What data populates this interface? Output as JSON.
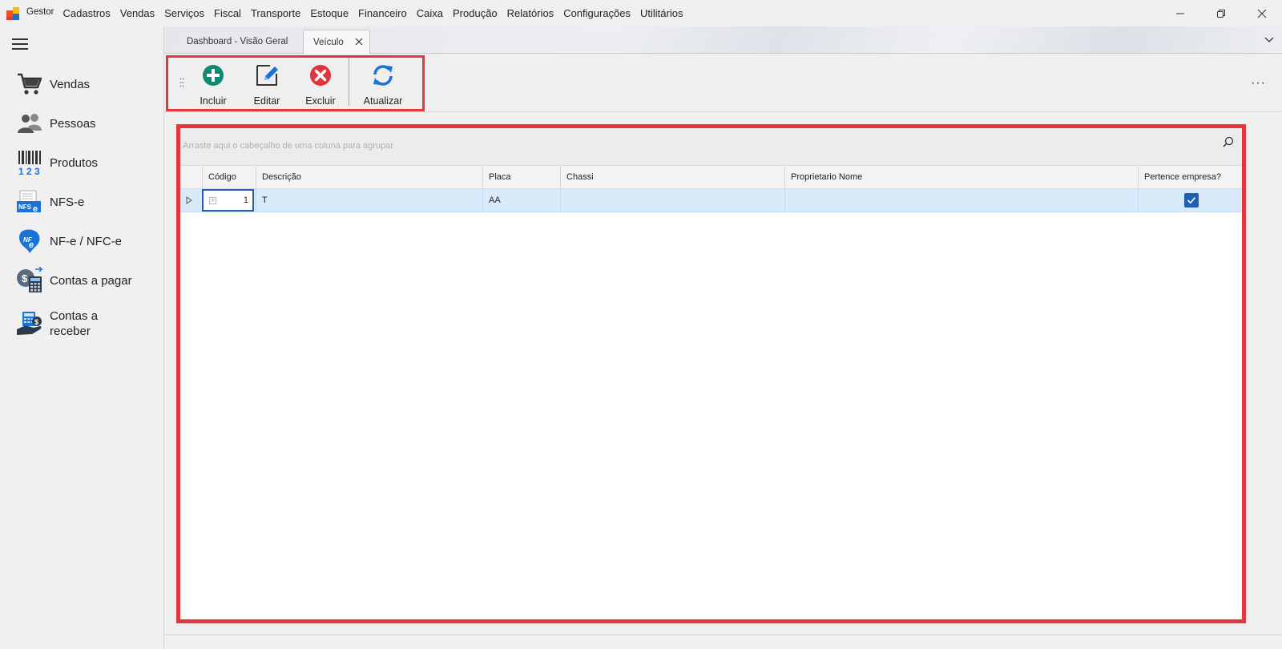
{
  "menubar": {
    "app_name": "Gestor",
    "items": [
      "Cadastros",
      "Vendas",
      "Serviços",
      "Fiscal",
      "Transporte",
      "Estoque",
      "Financeiro",
      "Caixa",
      "Produção",
      "Relatórios",
      "Configurações",
      "Utilitários"
    ],
    "window_controls": [
      "minimize-icon",
      "restore-icon",
      "close-icon"
    ]
  },
  "sidebar": {
    "menu_icon": "hamburger-icon",
    "items": [
      {
        "label": "Vendas",
        "icon": "cart-icon"
      },
      {
        "label": "Pessoas",
        "icon": "people-icon"
      },
      {
        "label": "Produtos",
        "icon": "barcode-icon"
      },
      {
        "label": "NFS-e",
        "icon": "nfse-icon"
      },
      {
        "label": "NF-e / NFC-e",
        "icon": "nfe-icon"
      },
      {
        "label": "Contas a pagar",
        "icon": "calculator-coin-icon"
      },
      {
        "label": "Contas a\nreceber",
        "icon": "hand-money-icon"
      }
    ]
  },
  "tabs": [
    {
      "label": "Dashboard - Visão Geral",
      "active": false
    },
    {
      "label": "Veículo",
      "active": true
    }
  ],
  "toolbar": {
    "buttons": [
      {
        "label": "Incluir",
        "icon": "plus-circle-icon",
        "color": "#0e8a72"
      },
      {
        "label": "Editar",
        "icon": "edit-icon",
        "color": "#1a73d9"
      },
      {
        "label": "Excluir",
        "icon": "x-circle-icon",
        "color": "#e3343b"
      },
      {
        "label": "Atualizar",
        "icon": "refresh-icon",
        "color": "#1a73d9"
      }
    ],
    "more_label": "···"
  },
  "grid": {
    "group_hint": "Arraste aqui o cabeçalho de uma coluna para agrupar",
    "columns": [
      "Código",
      "Descrição",
      "Placa",
      "Chassi",
      "Proprietario Nome",
      "Pertence empresa?"
    ],
    "rows": [
      {
        "codigo": "1",
        "descricao": "T",
        "placa": "AA",
        "chassi": "",
        "proprietario_nome": "",
        "pertence_empresa": true
      }
    ]
  },
  "colors": {
    "highlight_frame": "#e4363b",
    "selected_row": "#d9eafb",
    "checkbox": "#1f5fb5"
  }
}
